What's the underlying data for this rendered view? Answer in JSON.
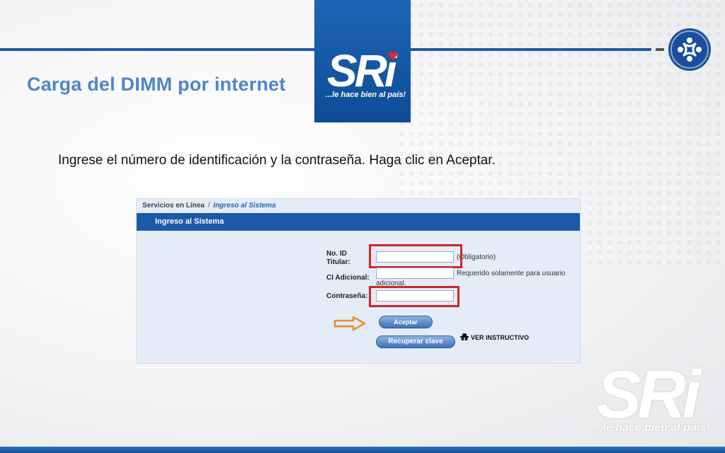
{
  "slide": {
    "title": "Carga del DIMM por internet",
    "instruction": "Ingrese el número de identificación y la contraseña. Haga clic en Aceptar."
  },
  "brand": {
    "logo_text": "SRi",
    "tagline": "...le hace bien al país!",
    "watermark_text": "SRi",
    "watermark_tagline": "...le hace bien al país!",
    "primary_color": "#1c5aa8",
    "title_color": "#4d86c9",
    "highlight_color": "#d4232a",
    "arrow_color": "#f0892a"
  },
  "screenshot": {
    "breadcrumb": {
      "root": "Servicios en Línea",
      "separator": "/",
      "current": "Ingreso al Sistema"
    },
    "header": "Ingreso al Sistema",
    "form": {
      "id_label_line1": "No. ID",
      "id_label_line2": "Titular:",
      "id_value": "",
      "id_hint": "(Obligatorio)",
      "ci_label": "CI Adicional:",
      "ci_value": "",
      "ci_hint_line1": "Requerido solamente para usuario",
      "ci_hint_line2": "adicional.",
      "password_label": "Contraseña:",
      "password_value": "",
      "accept_button": "Aceptar",
      "recover_button": "Recuperar clave",
      "instructivo_link": "VER INSTRUCTIVO"
    }
  },
  "icons": {
    "corner_logo": "community-circle-icon",
    "arrow": "right-arrow-icon",
    "instructivo": "spy-icon",
    "heart": "heart-icon"
  }
}
